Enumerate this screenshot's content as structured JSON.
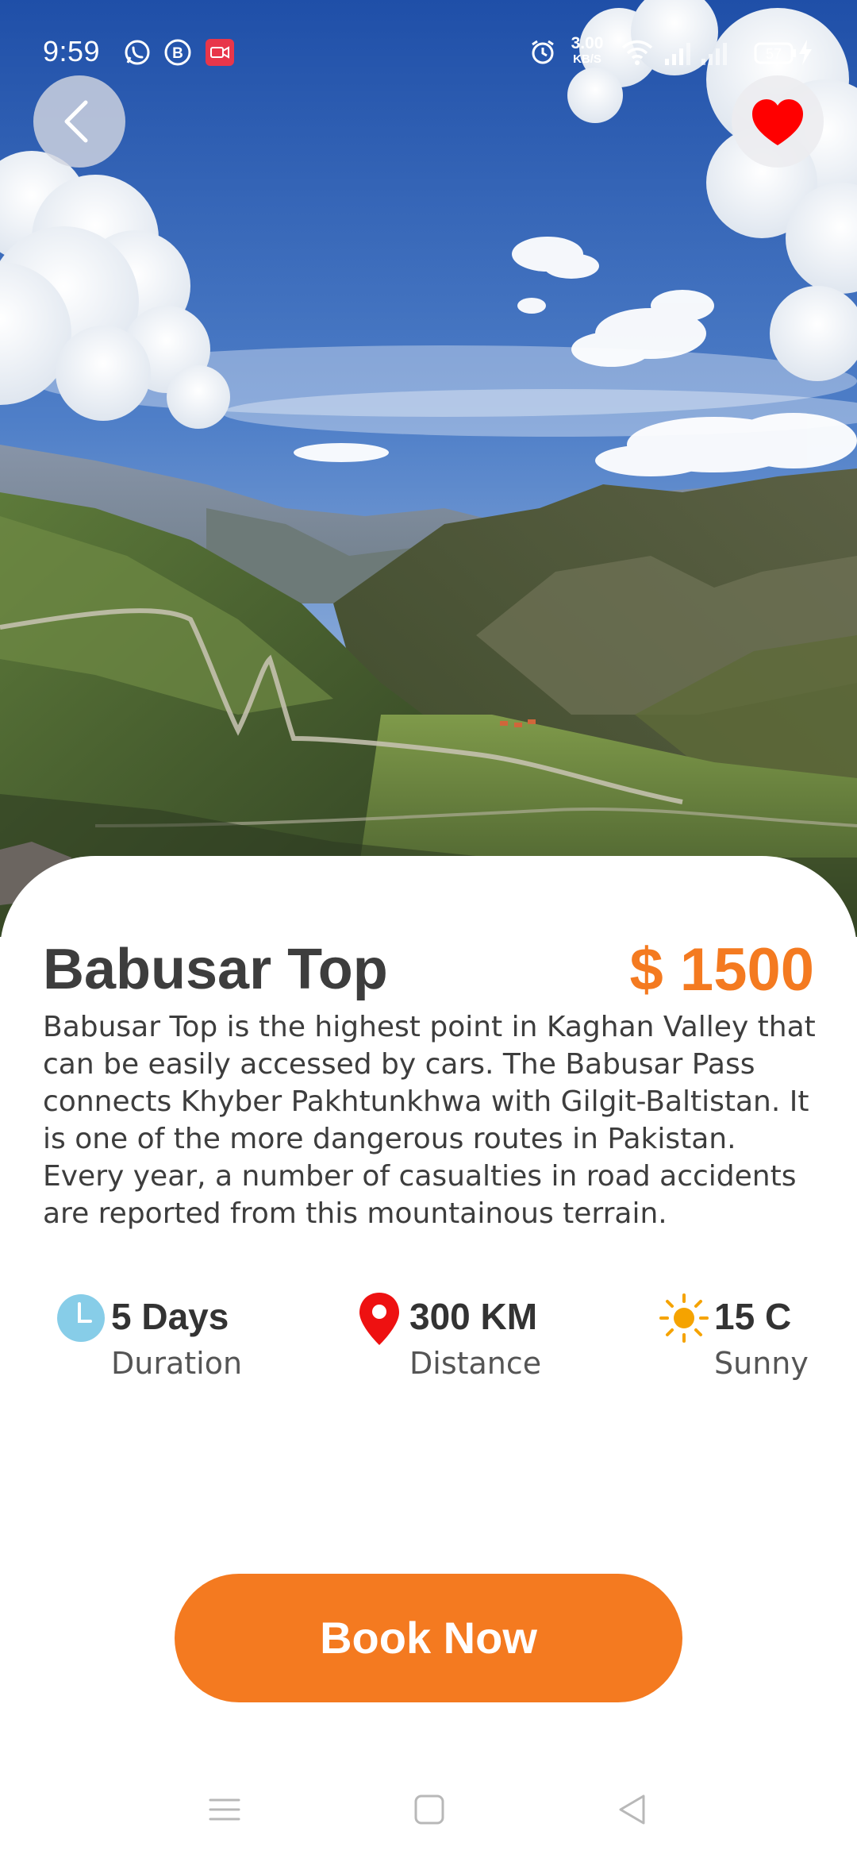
{
  "status_bar": {
    "time": "9:59",
    "net_speed_value": "3.00",
    "net_speed_unit": "KB/S",
    "battery": "57",
    "icons": [
      "whatsapp-icon",
      "b-badge-icon",
      "screen-record-icon",
      "alarm-icon",
      "wifi-icon",
      "signal-icon",
      "signal-icon-2",
      "battery-icon",
      "charging-icon"
    ]
  },
  "header": {
    "back_icon": "chevron-left-icon",
    "favorite_icon": "heart-icon",
    "favorite_color": "#ff0000"
  },
  "place": {
    "title": "Babusar Top",
    "price": "$ 1500",
    "description": "Babusar Top is the highest point in Kaghan Valley that can be easily accessed by cars. The Babusar Pass connects Khyber Pakhtunkhwa with Gilgit-Baltistan. It is one of the more dangerous routes in Pakistan. Every year, a number of casualties in road accidents are reported from this mountainous terrain."
  },
  "stats": [
    {
      "icon": "clock-icon",
      "value": "5 Days",
      "label": "Duration",
      "color": "#87cde8"
    },
    {
      "icon": "location-pin-icon",
      "value": "300 KM",
      "label": "Distance",
      "color": "#ee1111"
    },
    {
      "icon": "sun-icon",
      "value": "15 C",
      "label": "Sunny",
      "color": "#f5a300"
    }
  ],
  "actions": {
    "book_label": "Book Now"
  },
  "colors": {
    "accent": "#f47a20",
    "text_dark": "#3d3d3d"
  },
  "nav_bar": {
    "icons": [
      "menu-icon",
      "home-square-icon",
      "back-triangle-icon"
    ]
  }
}
